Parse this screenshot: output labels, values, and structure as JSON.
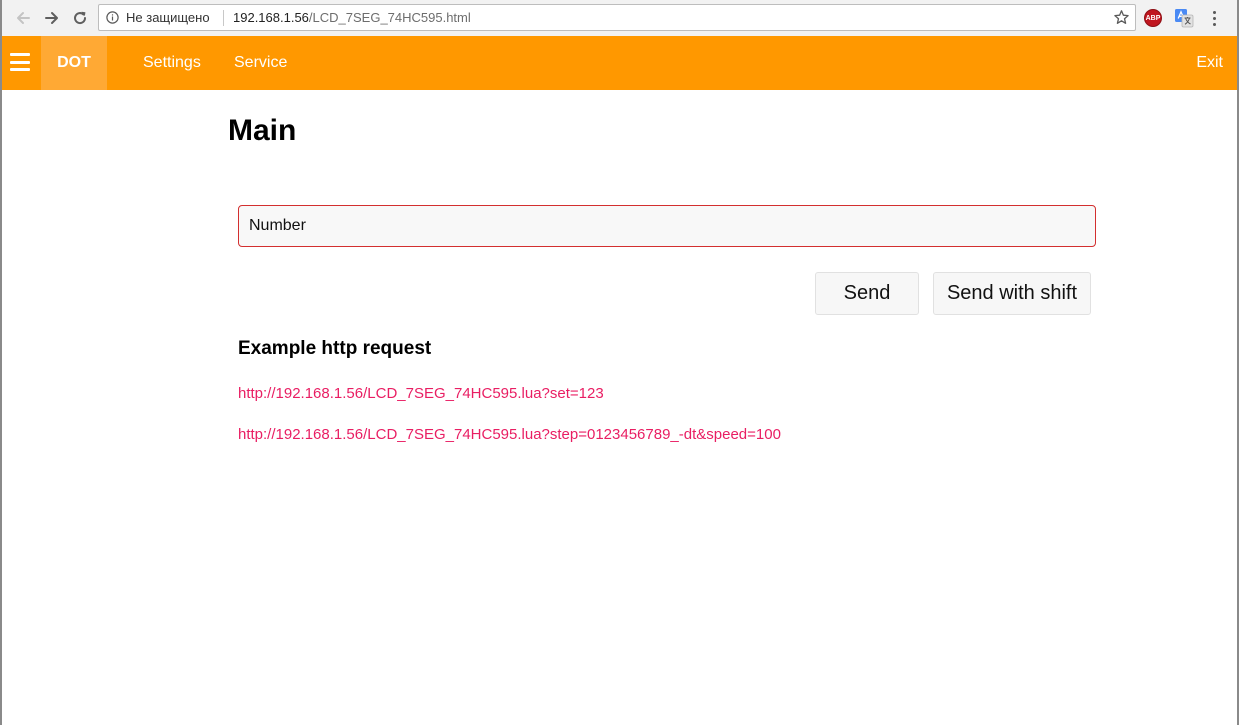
{
  "browser": {
    "security_label": "Не защищено",
    "url_host": "192.168.1.56",
    "url_path": "/LCD_7SEG_74HC595.html",
    "extensions": {
      "adblock_label": "ABP"
    }
  },
  "navbar": {
    "brand_label": "DOT",
    "items": [
      {
        "label": "Settings"
      },
      {
        "label": "Service"
      }
    ],
    "exit_label": "Exit",
    "color": "#ff9800"
  },
  "main": {
    "title": "Main",
    "number_input": {
      "placeholder": "Number",
      "value": ""
    },
    "send_label": "Send",
    "send_shift_label": "Send with shift",
    "example_heading": "Example http request",
    "examples": [
      {
        "url": "http://192.168.1.56/LCD_7SEG_74HC595.lua?set=123"
      },
      {
        "url": "http://192.168.1.56/LCD_7SEG_74HC595.lua?step=0123456789_-dt&speed=100"
      }
    ],
    "link_color": "#e91e63"
  }
}
